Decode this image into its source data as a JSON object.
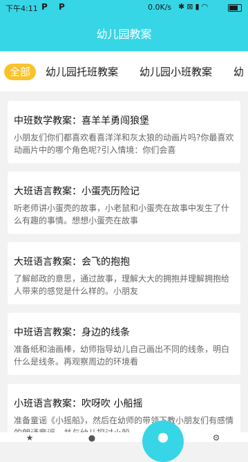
{
  "status_bar": {
    "time": "下午4:11",
    "notif_icons": "P P",
    "speed": "0.0K/s",
    "icons": [
      "bluetooth-icon",
      "signal-x-icon",
      "signal-bars-icon",
      "wifi-icon",
      "battery-icon"
    ]
  },
  "header": {
    "title": "幼儿园教案"
  },
  "tabs": [
    {
      "label": "全部",
      "active": true
    },
    {
      "label": "幼儿园托班教案",
      "active": false
    },
    {
      "label": "幼儿园小班教案",
      "active": false
    },
    {
      "label": "幼",
      "active": false
    }
  ],
  "articles": [
    {
      "title": "中班数学教案：喜羊羊勇闯狼堡",
      "summary": "小朋友们你们都喜欢看喜洋洋和灰太狼的动画片吗?你最喜欢动画片中的哪个角色呢?引入情境：你们会喜"
    },
    {
      "title": "大班语言教案：小蛋壳历险记",
      "summary": "听老师讲小蛋壳的故事，小老鼠和小蛋壳在故事中发生了什么有趣的事情。想想小蛋壳在故事"
    },
    {
      "title": "大班语言教案：会飞的抱抱",
      "summary": "了解邮政的意思，通过故事，理解大大的拥抱并理解拥抱给人带来的感觉是什么样的。小朋友"
    },
    {
      "title": "中班语言教案：身边的线条",
      "summary": "准备纸和油画棒，幼师指导幼儿自己画出不同的线条，明白什么是线条。再观察周边的环境看"
    },
    {
      "title": "小班语言教案：吹呀吹 小船摇",
      "summary": "准备童谣《小摇船》，然后在幼师的带领下教小朋友们有感情的朗诵童谣，并与幼儿探讨小船"
    }
  ],
  "colors": {
    "primary": "#37d6e6",
    "active_tab": "#f8c32b"
  },
  "bottom_nav": [
    "star-icon",
    "palette-icon",
    "center-home-icon",
    "settings-icon"
  ]
}
